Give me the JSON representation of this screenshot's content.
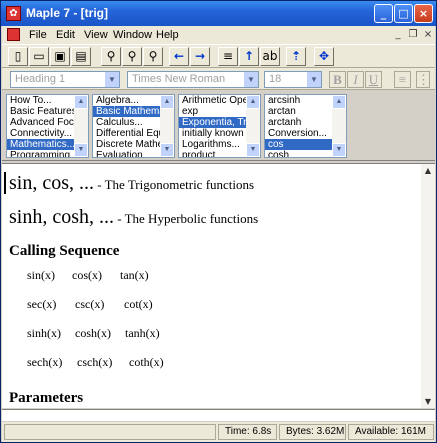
{
  "window": {
    "title": "Maple 7 - [trig]"
  },
  "menu": [
    "File",
    "Edit",
    "View",
    "Window",
    "Help"
  ],
  "toolbar": {
    "buttons": [
      "new-icon",
      "open-icon",
      "save-icon",
      "print-icon",
      "zoom-100-icon",
      "zoom-200-icon",
      "zoom-400-icon",
      "back-icon",
      "forward-icon",
      "text-icon",
      "up-arrow-icon",
      "abc-icon",
      "up-icon",
      "move-icon"
    ]
  },
  "format": {
    "style": "Heading 1",
    "font": "Times New Roman",
    "size": "18",
    "bold": "B",
    "italic": "I",
    "underline": "U"
  },
  "browser": {
    "lists": [
      {
        "items": [
          "How To...",
          "Basic Features",
          "Advanced Foc",
          "Connectivity...",
          "Mathematics...",
          "Programming"
        ],
        "selected": 4
      },
      {
        "items": [
          "Algebra...",
          "Basic Mathema",
          "Calculus...",
          "Differential Equ",
          "Discrete Mathe",
          "Evaluation"
        ],
        "selected": 1
      },
      {
        "items": [
          "Arithmetic Oper",
          "exp",
          "Exponentia, Tr",
          "initially known f",
          "Logarithms...",
          "product"
        ],
        "selected": 2
      },
      {
        "items": [
          "arcsinh",
          "arctan",
          "arctanh",
          "Conversion...",
          "cos",
          "cosh"
        ],
        "selected": 4
      }
    ]
  },
  "doc": {
    "heading1_big": "sin, cos, ...",
    "heading1_small": " - The Trigonometric functions",
    "heading2_big": "sinh, cosh, ...",
    "heading2_small": " - The Hyperbolic functions",
    "calling_sequence": "Calling Sequence",
    "seq_rows": [
      [
        "sin(x)",
        "cos(x)",
        "tan(x)"
      ],
      [
        "sec(x)",
        "csc(x)",
        "cot(x)"
      ],
      [
        "sinh(x)",
        "cosh(x)",
        "tanh(x)"
      ],
      [
        "sech(x)",
        "csch(x)",
        "coth(x)"
      ]
    ],
    "parameters": "Parameters"
  },
  "status": {
    "time": "Time:   6.8s",
    "bytes": "Bytes:  3.62M",
    "available": "Available: 161M"
  }
}
